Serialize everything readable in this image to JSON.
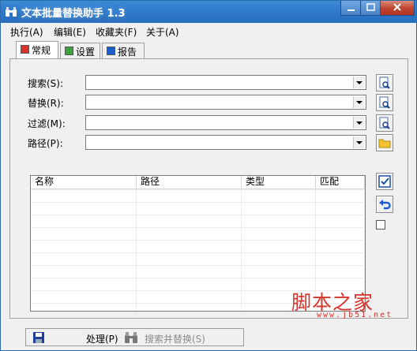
{
  "window": {
    "title": "文本批量替换助手 1.3",
    "controls": {
      "minimize": "—",
      "maximize": "□",
      "close": "✕"
    }
  },
  "menubar": [
    {
      "label": "执行(A)"
    },
    {
      "label": "编辑(E)"
    },
    {
      "label": "收藏夹(F)"
    },
    {
      "label": "关于(A)"
    }
  ],
  "tabs": [
    {
      "label": "常规",
      "icon": "red-square-icon",
      "active": true
    },
    {
      "label": "设置",
      "icon": "green-square-icon",
      "active": false
    },
    {
      "label": "报告",
      "icon": "blue-square-icon",
      "active": false
    }
  ],
  "fields": [
    {
      "label": "搜索(S):",
      "value": "",
      "button_icon": "search-doc-icon"
    },
    {
      "label": "替换(R):",
      "value": "",
      "button_icon": "search-doc-icon"
    },
    {
      "label": "过滤(M):",
      "value": "",
      "button_icon": "search-doc-icon"
    },
    {
      "label": "路径(P):",
      "value": "",
      "button_icon": "folder-icon"
    }
  ],
  "results_table": {
    "columns": [
      "名称",
      "路径",
      "类型",
      "匹配"
    ],
    "rows": []
  },
  "side_buttons": {
    "check_all": "check-icon",
    "undo": "undo-icon"
  },
  "bottom_bar": {
    "process_label": "处理(P)",
    "search_replace_label": "搜索并替换(S)"
  },
  "watermark": {
    "text": "脚本之家",
    "url": "www.jb51.net"
  },
  "colors": {
    "titlebar": "#2c76c6",
    "watermark": "#d9342b",
    "tab_red": "#e0302a",
    "tab_green": "#3aa63a",
    "tab_blue": "#1e5fcf"
  }
}
